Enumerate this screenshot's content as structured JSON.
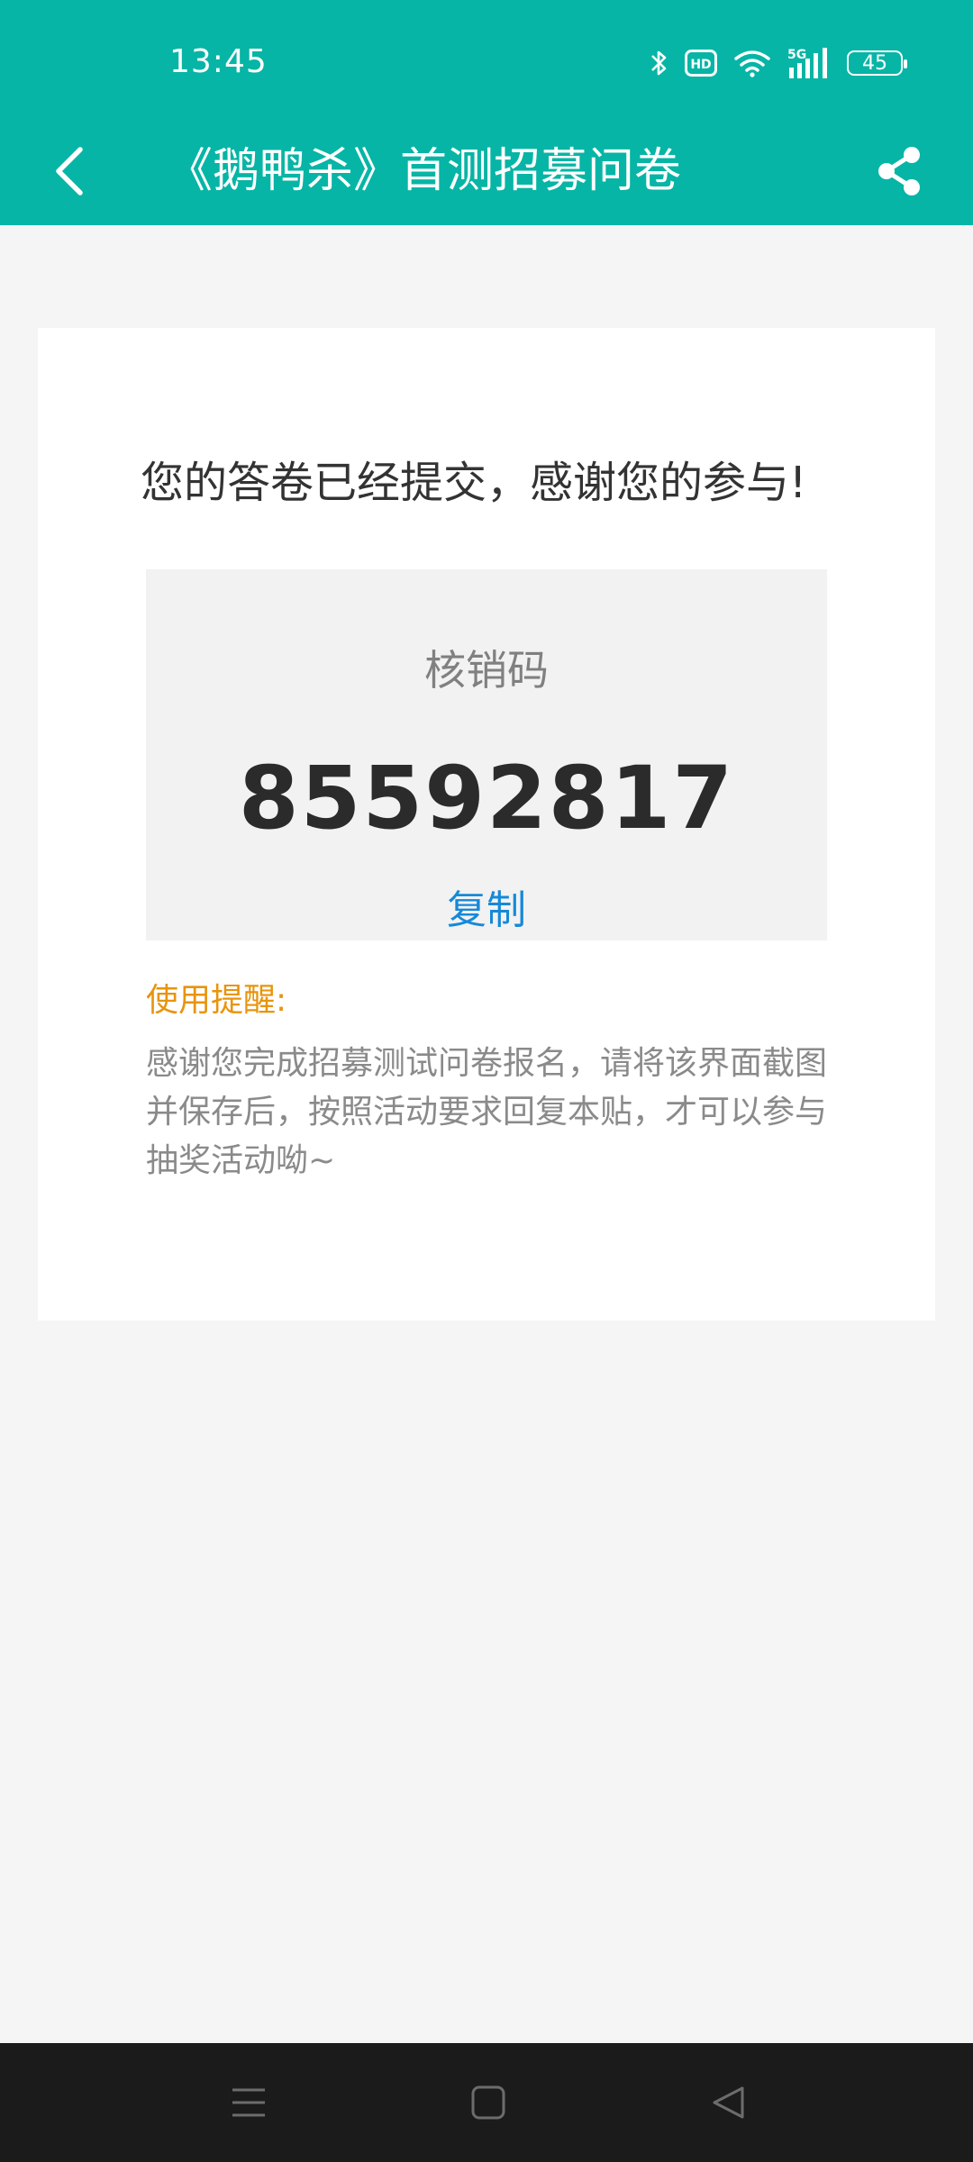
{
  "status_bar": {
    "time": "13:45",
    "battery": "45",
    "network": "5G",
    "icons": [
      "bluetooth-icon",
      "hd-icon",
      "wifi-icon",
      "signal-icon",
      "battery-icon"
    ]
  },
  "header": {
    "title": "《鹅鸭杀》首测招募问卷",
    "background_color": "#06b5a5",
    "back_icon": "chevron-left-icon",
    "share_icon": "share-icon"
  },
  "main": {
    "success_message": "您的答卷已经提交，感谢您的参与!",
    "code_box": {
      "label": "核销码",
      "value": "85592817",
      "copy_label": "复制"
    },
    "tip": {
      "title": "使用提醒:",
      "body": "感谢您完成招募测试问卷报名，请将该界面截图并保存后，按照活动要求回复本贴，才可以参与抽奖活动呦~"
    }
  },
  "bottom_nav": {
    "buttons": [
      "menu-icon",
      "home-icon",
      "back-triangle-icon"
    ]
  }
}
